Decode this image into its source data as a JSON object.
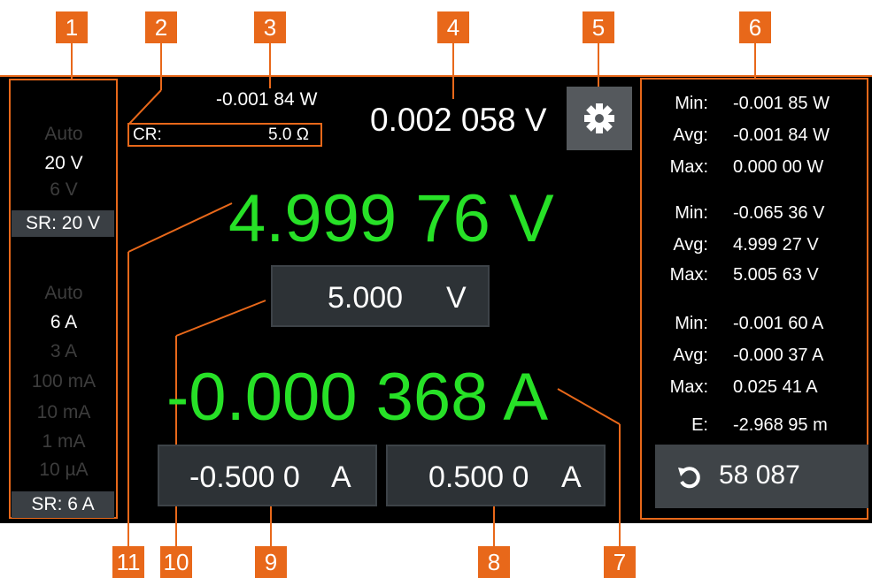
{
  "callouts": [
    "1",
    "2",
    "3",
    "4",
    "5",
    "6",
    "7",
    "8",
    "9",
    "10",
    "11"
  ],
  "colors": {
    "accent": "#e8681a",
    "measure": "#27e127",
    "screen": "#000000",
    "field": "#2d3236"
  },
  "voltage_ranges": {
    "items": [
      "Auto",
      "20 V",
      "6 V"
    ],
    "active": "20 V",
    "sr": "SR: 20 V"
  },
  "current_ranges": {
    "items": [
      "Auto",
      "6 A",
      "3 A",
      "100 mA",
      "10 mA",
      "1 mA",
      "10 µA"
    ],
    "active": "6 A",
    "sr": "SR: 6 A"
  },
  "power_reading": "-0.001 84 W",
  "cr_label": "CR:",
  "cr_value": "5.0 Ω",
  "top_voltage": "0.002 058 V",
  "settings_icon": "gear-icon",
  "main_voltage": "4.999 76 V",
  "voltage_setpoint": {
    "value": "5.000",
    "unit": "V"
  },
  "main_current": "-0.000 368 A",
  "current_limit_low": {
    "value": "-0.500 0",
    "unit": "A"
  },
  "current_limit_high": {
    "value": "0.500 0",
    "unit": "A"
  },
  "stats": [
    {
      "label": "Min:",
      "value": "-0.001 85 W"
    },
    {
      "label": "Avg:",
      "value": "-0.001 84 W"
    },
    {
      "label": "Max:",
      "value": "0.000 00 W"
    },
    {
      "label": "Min:",
      "value": "-0.065 36 V"
    },
    {
      "label": "Avg:",
      "value": "4.999 27 V"
    },
    {
      "label": "Max:",
      "value": "5.005 63 V"
    },
    {
      "label": "Min:",
      "value": "-0.001 60 A"
    },
    {
      "label": "Avg:",
      "value": "-0.000 37 A"
    },
    {
      "label": "Max:",
      "value": "0.025 41 A"
    },
    {
      "label": "E:",
      "value": "-2.968 95 m"
    }
  ],
  "reset_button": {
    "icon": "reset-icon",
    "count": "58 087"
  }
}
